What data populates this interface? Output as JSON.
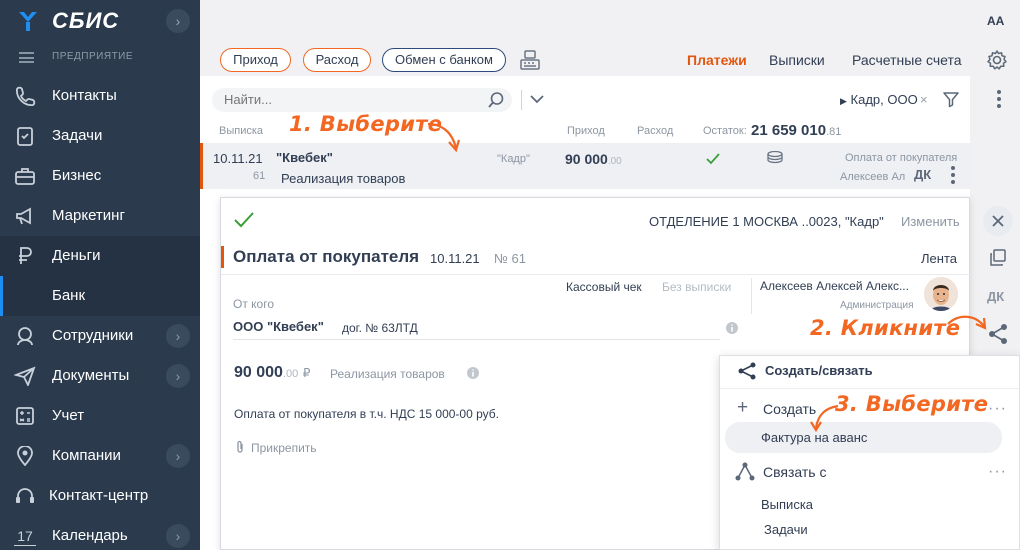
{
  "sidebar": {
    "brand": "СБИС",
    "section": "ПРЕДПРИЯТИЕ",
    "items": [
      {
        "label": "Контакты"
      },
      {
        "label": "Задачи"
      },
      {
        "label": "Бизнес"
      },
      {
        "label": "Маркетинг"
      },
      {
        "label": "Деньги"
      },
      {
        "label": "Банк"
      },
      {
        "label": "Сотрудники"
      },
      {
        "label": "Документы"
      },
      {
        "label": "Учет"
      },
      {
        "label": "Компании"
      },
      {
        "label": "Контакт-центр"
      },
      {
        "label": "Календарь",
        "badge": "17"
      }
    ]
  },
  "topbar": {
    "font_size_toggle": "AA",
    "buttons": {
      "income": "Приход",
      "expense": "Расход",
      "bank_exchange": "Обмен с банком"
    },
    "tabs": [
      "Платежи",
      "Выписки",
      "Расчетные счета"
    ],
    "active_tab": "Платежи"
  },
  "list": {
    "search_placeholder": "Найти...",
    "filter_chip": "Кадр, ООО",
    "filter_close": "×",
    "headers": {
      "statement": "Выписка",
      "income": "Приход",
      "expense": "Расход",
      "balance_label": "Остаток:"
    },
    "balance": {
      "main": "21 659 010",
      "dec": ".81"
    },
    "rows": [
      {
        "date": "10.11.21",
        "number": "61",
        "counterparty": "\"Квебек\"",
        "description": "Реализация товаров",
        "org": "\"Кадр\"",
        "amount": "90 000",
        "amount_dec": ".00",
        "operation": "Оплата от покупателя",
        "person": "Алексеев Ал",
        "badge": "ДК"
      }
    ]
  },
  "card": {
    "branch": "ОТДЕЛЕНИЕ 1 МОСКВА ..0023, \"Кадр\"",
    "edit": "Изменить",
    "title": "Оплата от покупателя",
    "date": "10.11.21",
    "number": "№ 61",
    "feed": "Лента",
    "cash_check": "Кассовый чек",
    "no_statement": "Без выписки",
    "person_name": "Алексеев Алексей Алекс...",
    "person_dept": "Администрация",
    "from_label": "От кого",
    "from_value": "ООО \"Квебек\"",
    "contract": "дог. № 63ЛТД",
    "amount": "90 000",
    "amount_dec": ".00",
    "currency": "₽",
    "amount_desc": "Реализация товаров",
    "vat_text": "Оплата от покупателя в т.ч. НДС 15 000-00 руб.",
    "attach": "Прикрепить",
    "side_dk": "ДК"
  },
  "menu": {
    "header": "Создать/связать",
    "create": "Создать",
    "invoice": "Фактура на аванс",
    "link": "Связать с",
    "statement": "Выписка",
    "tasks": "Задачи",
    "dots": "···"
  },
  "annotations": {
    "step1": "1. Выберите",
    "step2": "2. Кликните",
    "step3": "3. Выберите"
  },
  "colors": {
    "sidebar_bg": "#2b3a4c",
    "accent": "#e2560e",
    "annotation": "#f26722",
    "link_blue": "#2c4a7a",
    "check_green": "#3a9f3a"
  }
}
